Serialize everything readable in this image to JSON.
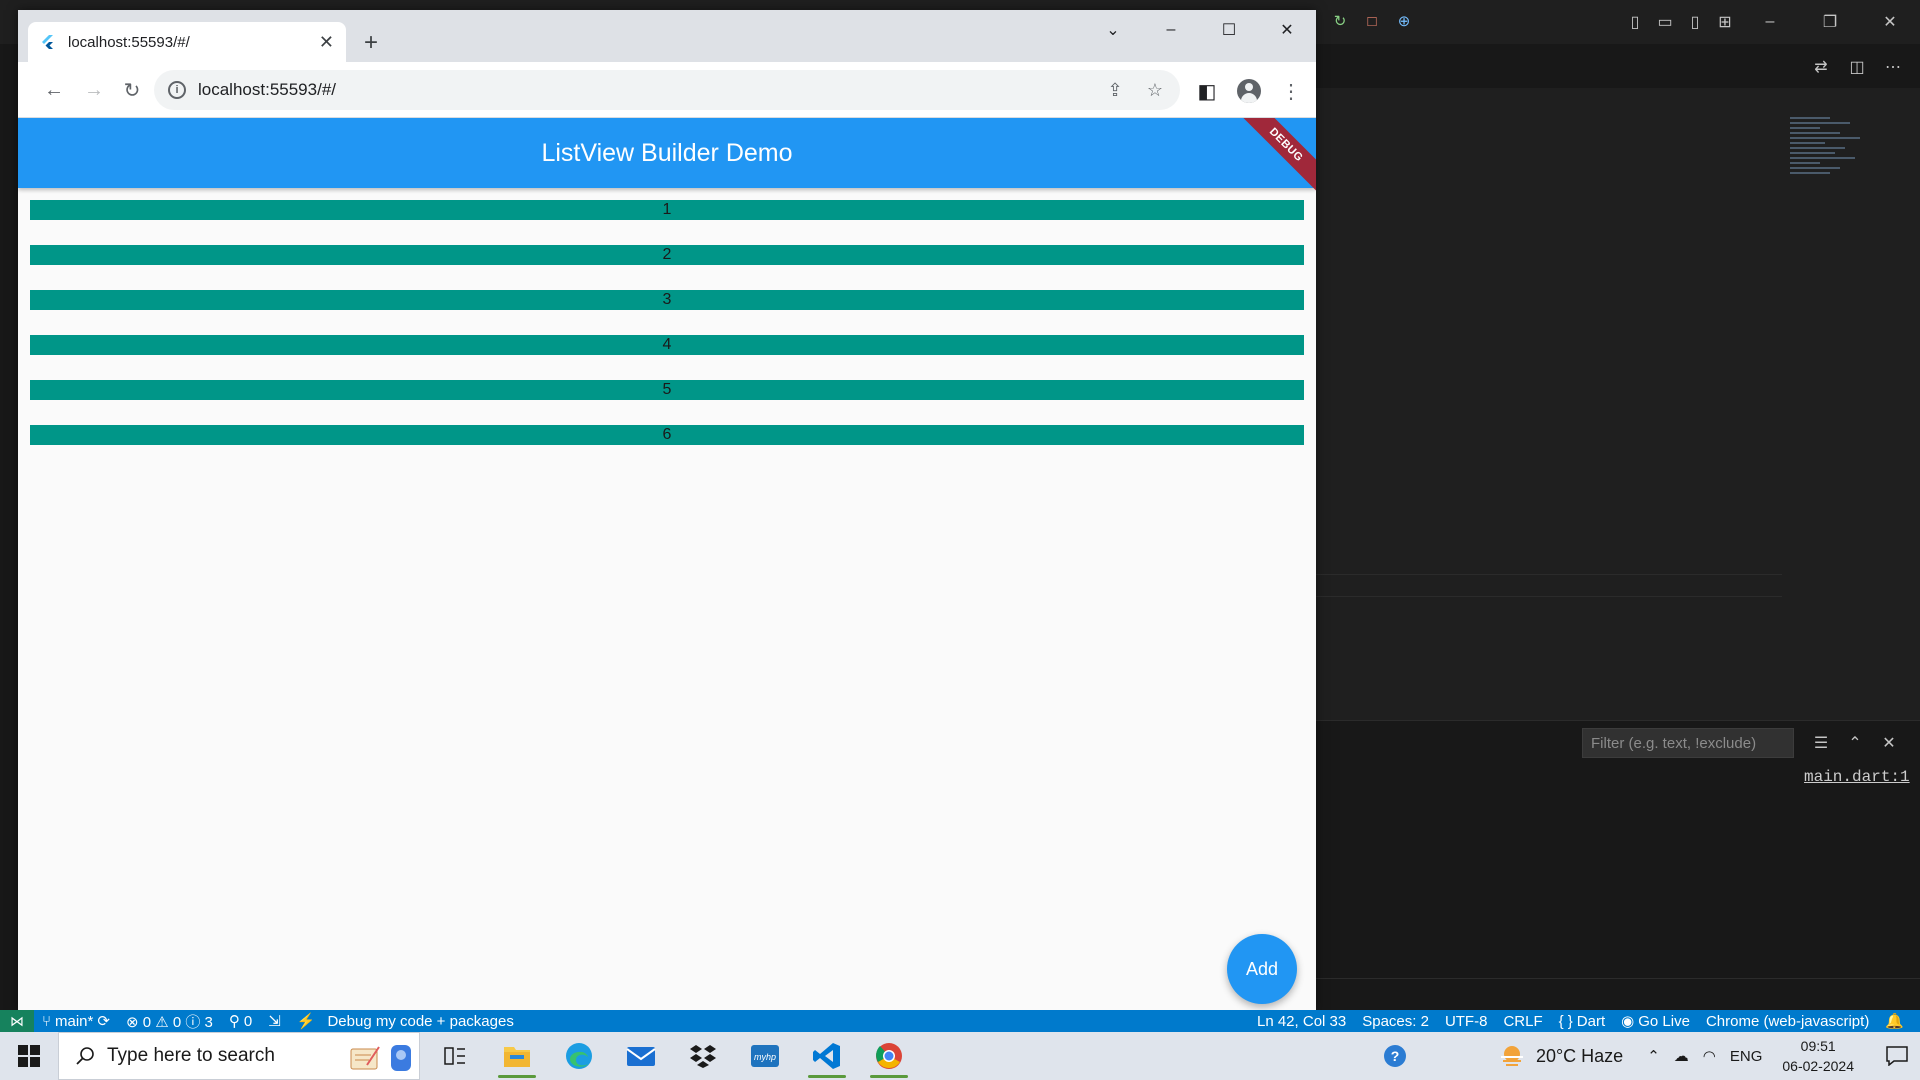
{
  "browser": {
    "tab_title": "localhost:55593/#/",
    "url": "localhost:55593/#/"
  },
  "app": {
    "title": "ListView Builder Demo",
    "debug_banner": "DEBUG",
    "items": [
      "1",
      "2",
      "3",
      "4",
      "5",
      "6"
    ],
    "fab_label": "Add",
    "colors": {
      "appbar": "#2196f3",
      "item": "#009688"
    }
  },
  "vscode": {
    "filter_placeholder": "Filter (e.g. text, !exclude)",
    "output_link": "main.dart:1"
  },
  "statusbar": {
    "branch": "main*",
    "problems": "⊗ 0 ⚠ 0 ⓘ 3",
    "ports": "0",
    "debug": "Debug my code + packages",
    "position": "Ln 42, Col 33",
    "spaces": "Spaces: 2",
    "encoding": "UTF-8",
    "eol": "CRLF",
    "language": "Dart",
    "golive": "Go Live",
    "device": "Chrome (web-javascript)"
  },
  "taskbar": {
    "search_placeholder": "Type here to search",
    "weather": "20°C  Haze",
    "language": "ENG",
    "time": "09:51",
    "date": "06-02-2024"
  }
}
